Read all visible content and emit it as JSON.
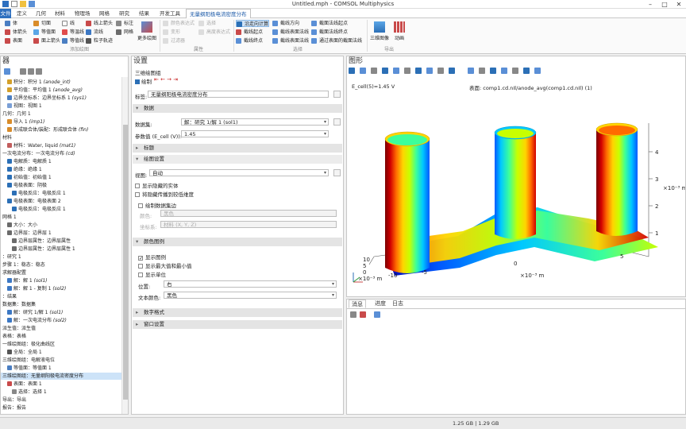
{
  "window": {
    "title": "Untitled.mph - COMSOL Multiphysics"
  },
  "tabs": [
    "文件",
    "定义",
    "几何",
    "材料",
    "物理场",
    "网格",
    "研究",
    "结果",
    "开发工具",
    "无量纲阳极电流密度分布"
  ],
  "ribbon": {
    "add_plots": [
      "体",
      "切面",
      "线",
      "线上箭头",
      "标注",
      "体箭头",
      "等值面",
      "等温线",
      "面上箭头",
      "流线",
      "表面",
      "面上箭头",
      "等值线",
      "粒子轨迹",
      "网格"
    ],
    "more_plots": "更多绘图",
    "attributes": [
      "颜色表达式",
      "选择",
      "变形",
      "高度表达式",
      "过滤器"
    ],
    "selection_tools": [
      "沿走向计算",
      "截线方向",
      "截面法线起点",
      "截线起点",
      "截线表面法线",
      "截面法线终点",
      "截线终点",
      "截线表面法线",
      "通过表面的截面法线"
    ],
    "view_buttons": [
      "三维图像",
      "动画"
    ],
    "groups": [
      "添加绘图",
      "属性",
      "选择",
      "导出"
    ]
  },
  "model_builder": {
    "title": "器",
    "items": [
      {
        "text": "积分：积分 1 ",
        "italic": "(anode_int)",
        "indent": 6,
        "color": "#d4a02a"
      },
      {
        "text": "平均值：平均值 1 ",
        "italic": "(anode_avg)",
        "indent": 6,
        "color": "#d4a02a"
      },
      {
        "text": "边界坐标系：边界坐标系 1 ",
        "italic": "(sys1)",
        "indent": 6,
        "color": "#4a7ec2"
      },
      {
        "text": "视图：视图 1",
        "indent": 6,
        "color": "#7a9fd6"
      },
      {
        "text": "几何：几何 1",
        "indent": 0,
        "color": ""
      },
      {
        "text": "导入 1 ",
        "italic": "(imp1)",
        "indent": 6,
        "color": "#d98c2a"
      },
      {
        "text": "形成联合体/装配：形成联合体 ",
        "italic": "(fin)",
        "indent": 6,
        "color": "#d98c2a"
      },
      {
        "text": "材料",
        "indent": 0,
        "color": ""
      },
      {
        "text": "材料：Water, liquid ",
        "italic": "(mat1)",
        "indent": 6,
        "color": "#c25d5d"
      },
      {
        "text": "一次电流分布：一次电流分布 ",
        "italic": "(cd)",
        "indent": 0,
        "color": ""
      },
      {
        "text": "电解质：电解质 1",
        "indent": 6,
        "color": "#2b6fb6"
      },
      {
        "text": "绝缘：绝缘 1",
        "indent": 6,
        "color": "#2b6fb6"
      },
      {
        "text": "初始值：初始值 1",
        "indent": 6,
        "color": "#2b6fb6"
      },
      {
        "text": "电极表面：阴极",
        "indent": 6,
        "color": "#2b6fb6"
      },
      {
        "text": "电极反应：电极反应 1",
        "indent": 12,
        "color": "#2b6fb6"
      },
      {
        "text": "电极表面：电极表面 2",
        "indent": 6,
        "color": "#2b6fb6"
      },
      {
        "text": "电极反应：电极反应 1",
        "indent": 12,
        "color": "#2b6fb6"
      },
      {
        "text": "网格 1",
        "indent": 0,
        "color": ""
      },
      {
        "text": "大小：大小",
        "indent": 6,
        "color": "#6b6b6b"
      },
      {
        "text": "边界层：边界层 1",
        "indent": 6,
        "color": "#6b6b6b"
      },
      {
        "text": "边界层属性：边界层属性",
        "indent": 12,
        "color": "#6b6b6b"
      },
      {
        "text": "边界层属性：边界层属性 1",
        "indent": 12,
        "color": "#6b6b6b"
      },
      {
        "text": "：研究 1",
        "indent": 0,
        "color": ""
      },
      {
        "text": "步骤 1：稳态：稳态",
        "indent": 0,
        "color": ""
      },
      {
        "text": "求解器配置",
        "indent": 0,
        "color": ""
      },
      {
        "text": "解：解 1 ",
        "italic": "(sol1)",
        "indent": 6,
        "color": "#3c78c4"
      },
      {
        "text": "解：解 1 - 复制 1 ",
        "italic": "(sol2)",
        "indent": 6,
        "color": "#3c78c4"
      },
      {
        "text": "：结果",
        "indent": 0,
        "color": ""
      },
      {
        "text": "数据集：数据集",
        "indent": 0,
        "color": ""
      },
      {
        "text": "解：研究 1/解 1 ",
        "italic": "(sol1)",
        "indent": 6,
        "color": "#3c78c4"
      },
      {
        "text": "解：一次电流分布 ",
        "italic": "(sol2)",
        "indent": 6,
        "color": "#3c78c4"
      },
      {
        "text": "派生值：派生值",
        "indent": 0,
        "color": ""
      },
      {
        "text": "表格：表格",
        "indent": 0,
        "color": ""
      },
      {
        "text": "一维绘图组：极化曲线区",
        "indent": 0,
        "color": ""
      },
      {
        "text": "全局：全局 1",
        "indent": 6,
        "color": "#555"
      },
      {
        "text": "三维绘图组：电解液电位",
        "indent": 0,
        "color": ""
      },
      {
        "text": "等值面：等值面 1",
        "indent": 6,
        "color": "#4a7ec2"
      },
      {
        "text": "三维绘图组：无量纲阳极电流密度分布",
        "indent": 0,
        "color": "",
        "selected": true
      },
      {
        "text": "表面：表面 1",
        "indent": 6,
        "color": "#c94a4a"
      },
      {
        "text": "选择：选择 1",
        "indent": 12,
        "color": "#888"
      },
      {
        "text": "导出：导出",
        "indent": 0,
        "color": ""
      },
      {
        "text": "报告：报告",
        "indent": 0,
        "color": ""
      }
    ]
  },
  "settings": {
    "title": "设置",
    "subtitle": "三维绘图组",
    "plot_button": "绘制",
    "label_caption": "标签:",
    "label_value": "无量纲阳极电流密度分布",
    "sections": {
      "data": "数据",
      "title": "标题",
      "plot_settings": "绘图设置",
      "color_legend": "颜色图例",
      "number_format": "数字格式",
      "window_settings": "窗口设置"
    },
    "dataset_label": "数据集:",
    "dataset_value": "解：研究 1/解 1 (sol1)",
    "param_label": "参数值 (E_cell (V)):",
    "param_value": "1.45",
    "view_label": "视图:",
    "view_value": "自动",
    "cb_hidden": "显示隐藏的实体",
    "cb_propagate": "将隐藏传播到较低维度",
    "cb_frame": "绘制数据集边",
    "color_label": "颜色:",
    "color_value": "黑色",
    "frame_label": "坐标系:",
    "frame_value": "材料 (X, Y, Z)",
    "cb_show_legend": "显示图例",
    "cb_show_maxmin": "显示最大值和最小值",
    "cb_show_units": "显示单位",
    "position_label": "位置:",
    "position_value": "右",
    "text_color_label": "文本颜色:",
    "text_color_value": "黑色"
  },
  "graphics": {
    "title": "图形",
    "left_title": "E_cell(5)=1.45 V",
    "right_title": "表面: comp1.cd.nIl/anode_avg(comp1.cd.nIl) (1)",
    "z_ticks": [
      "4",
      "3",
      "2",
      "1"
    ],
    "z_unit": "×10⁻³ m",
    "x_ticks": [
      "-10",
      "-5",
      "0",
      "5"
    ],
    "x_unit": "×10⁻³ m",
    "y_ticks": [
      "10",
      "5",
      "0"
    ],
    "y_unit": "×10⁻³ m"
  },
  "bottom_panel": {
    "tabs": [
      "消息",
      "进度",
      "日志"
    ]
  },
  "status": {
    "memory": "1.25 GB | 1.29 GB"
  },
  "colors": {
    "ribbon_file_tab": "#2d6fbf",
    "selection": "#cde3f8",
    "rainbow": [
      "#0000b4",
      "#0059ff",
      "#00c8ff",
      "#3cff9a",
      "#c8ff00",
      "#ffd400",
      "#ff6a00",
      "#d10000",
      "#7a0000"
    ]
  }
}
